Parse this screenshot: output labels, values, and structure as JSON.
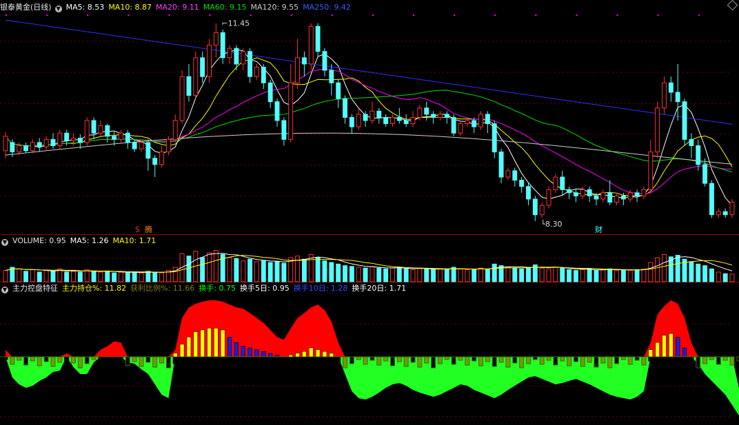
{
  "colors": {
    "up": "#ff3232",
    "down": "#54fcfc",
    "ma5": "#ffffff",
    "ma10": "#ffff00",
    "ma20": "#ff00ff",
    "ma60": "#00e000",
    "ma120": "#cccccc",
    "ma250": "#3030ff",
    "grid": "#7a0000"
  },
  "main_panel": {
    "title": "银泰黄金(日线)",
    "ma": [
      {
        "label": "MA5: 8.53",
        "color": "#ffffff"
      },
      {
        "label": "MA10: 8.87",
        "color": "#ffff00"
      },
      {
        "label": "MA20: 9.11",
        "color": "#ff40ff"
      },
      {
        "label": "MA60: 9.15",
        "color": "#00e000"
      },
      {
        "label": "MA120: 9.55",
        "color": "#cccccc"
      },
      {
        "label": "MA250: 9.42",
        "color": "#3a5cff"
      }
    ],
    "high_label": "11.45",
    "low_label": "8.30",
    "markers": [
      "S",
      "腾",
      "财"
    ]
  },
  "volume_panel": {
    "title": "VOLUME: 0.95",
    "ma": [
      {
        "label": "MA5: 1.26",
        "color": "#ffffff"
      },
      {
        "label": "MA10: 1.71",
        "color": "#ffff00"
      }
    ]
  },
  "indicator_panel": {
    "title": "主力控盘特征",
    "items": [
      {
        "label": "主力持仓%: 11.82",
        "color": "#ffff00"
      },
      {
        "label": "获利比例%: 11.66",
        "color": "#808000"
      },
      {
        "label": "换手: 0.75",
        "color": "#00ff00"
      },
      {
        "label": "换手5日: 0.95",
        "color": "#ffffff"
      },
      {
        "label": "换手10日: 1.28",
        "color": "#3050ff"
      },
      {
        "label": "换手20日: 1.71",
        "color": "#ffffff"
      }
    ]
  },
  "chart_data": {
    "type": "candlestick",
    "price_axis_range": [
      8.2,
      11.6
    ],
    "candles": [
      [
        9.42,
        9.65,
        9.3,
        9.72
      ],
      [
        9.55,
        9.4,
        9.32,
        9.6
      ],
      [
        9.4,
        9.5,
        9.35,
        9.55
      ],
      [
        9.5,
        9.42,
        9.38,
        9.55
      ],
      [
        9.42,
        9.55,
        9.38,
        9.6
      ],
      [
        9.55,
        9.48,
        9.4,
        9.62
      ],
      [
        9.48,
        9.6,
        9.42,
        9.65
      ],
      [
        9.6,
        9.5,
        9.45,
        9.7
      ],
      [
        9.5,
        9.7,
        9.45,
        9.75
      ],
      [
        9.7,
        9.58,
        9.5,
        9.75
      ],
      [
        9.58,
        9.62,
        9.5,
        9.7
      ],
      [
        9.62,
        9.55,
        9.45,
        9.68
      ],
      [
        9.55,
        9.9,
        9.5,
        9.95
      ],
      [
        9.9,
        9.7,
        9.6,
        9.95
      ],
      [
        9.7,
        9.82,
        9.65,
        9.9
      ],
      [
        9.82,
        9.65,
        9.55,
        9.85
      ],
      [
        9.65,
        9.6,
        9.5,
        9.72
      ],
      [
        9.6,
        9.7,
        9.55,
        9.75
      ],
      [
        9.7,
        9.55,
        9.45,
        9.75
      ],
      [
        9.55,
        9.45,
        9.4,
        9.6
      ],
      [
        9.45,
        9.55,
        9.4,
        9.6
      ],
      [
        9.55,
        9.3,
        9.1,
        9.6
      ],
      [
        9.3,
        9.2,
        9.0,
        9.35
      ],
      [
        9.2,
        9.4,
        9.15,
        9.5
      ],
      [
        9.4,
        9.6,
        9.35,
        9.65
      ],
      [
        9.6,
        9.9,
        9.55,
        10.0
      ],
      [
        9.9,
        10.6,
        9.85,
        10.7
      ],
      [
        10.6,
        10.3,
        10.2,
        10.8
      ],
      [
        10.3,
        10.9,
        10.25,
        11.0
      ],
      [
        10.9,
        10.6,
        10.5,
        11.0
      ],
      [
        10.6,
        11.1,
        10.5,
        11.2
      ],
      [
        11.1,
        11.3,
        10.9,
        11.45
      ],
      [
        11.3,
        10.9,
        10.8,
        11.35
      ],
      [
        10.9,
        11.05,
        10.8,
        11.1
      ],
      [
        11.05,
        10.8,
        10.7,
        11.1
      ],
      [
        10.8,
        11.0,
        10.7,
        11.05
      ],
      [
        11.0,
        10.6,
        10.5,
        11.05
      ],
      [
        10.6,
        10.75,
        10.55,
        10.8
      ],
      [
        10.75,
        10.5,
        10.4,
        10.8
      ],
      [
        10.5,
        10.2,
        10.1,
        10.55
      ],
      [
        10.2,
        9.9,
        9.8,
        10.25
      ],
      [
        9.9,
        9.6,
        9.5,
        9.95
      ],
      [
        9.6,
        10.5,
        9.55,
        10.8
      ],
      [
        10.5,
        10.9,
        10.4,
        11.2
      ],
      [
        10.9,
        10.8,
        10.6,
        11.0
      ],
      [
        10.8,
        11.4,
        10.7,
        11.45
      ],
      [
        11.4,
        11.0,
        10.9,
        11.45
      ],
      [
        11.0,
        10.7,
        10.6,
        11.05
      ],
      [
        10.7,
        10.5,
        10.3,
        10.8
      ],
      [
        10.5,
        10.25,
        10.1,
        10.55
      ],
      [
        10.25,
        9.95,
        9.85,
        10.3
      ],
      [
        9.95,
        9.8,
        9.7,
        10.0
      ],
      [
        9.8,
        10.0,
        9.75,
        10.1
      ],
      [
        10.0,
        9.9,
        9.8,
        10.05
      ],
      [
        9.9,
        10.05,
        9.85,
        10.2
      ],
      [
        10.05,
        9.95,
        9.85,
        10.1
      ],
      [
        9.95,
        9.85,
        9.8,
        10.0
      ],
      [
        9.85,
        9.95,
        9.8,
        10.0
      ],
      [
        9.95,
        9.9,
        9.85,
        10.1
      ],
      [
        9.9,
        9.85,
        9.8,
        10.0
      ],
      [
        9.85,
        9.95,
        9.8,
        10.05
      ],
      [
        9.95,
        10.1,
        9.9,
        10.15
      ],
      [
        10.1,
        10.0,
        9.9,
        10.2
      ],
      [
        10.0,
        9.95,
        9.85,
        10.05
      ],
      [
        9.95,
        10.0,
        9.9,
        10.05
      ],
      [
        10.0,
        9.95,
        9.85,
        10.05
      ],
      [
        9.95,
        9.7,
        9.65,
        10.0
      ],
      [
        9.7,
        9.85,
        9.65,
        9.9
      ],
      [
        9.85,
        9.9,
        9.8,
        9.95
      ],
      [
        9.9,
        9.8,
        9.7,
        9.95
      ],
      [
        9.8,
        10.0,
        9.75,
        10.05
      ],
      [
        10.0,
        9.85,
        9.7,
        10.05
      ],
      [
        9.85,
        9.4,
        9.3,
        9.9
      ],
      [
        9.4,
        9.0,
        8.9,
        9.45
      ],
      [
        9.0,
        9.1,
        8.95,
        9.15
      ],
      [
        9.1,
        8.95,
        8.85,
        9.15
      ],
      [
        8.95,
        8.85,
        8.75,
        9.0
      ],
      [
        8.85,
        8.65,
        8.55,
        8.9
      ],
      [
        8.65,
        8.4,
        8.3,
        8.7
      ],
      [
        8.4,
        8.55,
        8.35,
        8.6
      ],
      [
        8.55,
        8.8,
        8.5,
        8.85
      ],
      [
        8.8,
        9.0,
        8.75,
        9.05
      ],
      [
        9.0,
        8.8,
        8.7,
        9.1
      ],
      [
        8.8,
        8.75,
        8.65,
        8.85
      ],
      [
        8.75,
        8.7,
        8.6,
        8.8
      ],
      [
        8.7,
        8.8,
        8.65,
        8.85
      ],
      [
        8.8,
        8.7,
        8.6,
        8.85
      ],
      [
        8.7,
        8.65,
        8.55,
        8.75
      ],
      [
        8.65,
        8.75,
        8.6,
        8.8
      ],
      [
        8.75,
        8.6,
        8.55,
        8.95
      ],
      [
        8.6,
        8.7,
        8.55,
        8.75
      ],
      [
        8.7,
        8.65,
        8.55,
        8.75
      ],
      [
        8.65,
        8.75,
        8.6,
        8.8
      ],
      [
        8.75,
        8.7,
        8.6,
        8.8
      ],
      [
        8.7,
        8.8,
        8.65,
        8.85
      ],
      [
        8.8,
        9.4,
        8.75,
        9.6
      ],
      [
        9.4,
        10.1,
        9.3,
        10.2
      ],
      [
        10.1,
        10.5,
        10.0,
        10.6
      ],
      [
        10.5,
        10.35,
        10.2,
        10.6
      ],
      [
        10.35,
        10.2,
        9.9,
        10.8
      ],
      [
        10.2,
        9.6,
        9.5,
        10.25
      ],
      [
        9.6,
        9.5,
        9.3,
        9.7
      ],
      [
        9.5,
        9.2,
        9.1,
        9.6
      ],
      [
        9.2,
        8.9,
        8.85,
        9.3
      ],
      [
        8.9,
        8.4,
        8.35,
        8.95
      ],
      [
        8.4,
        8.45,
        8.35,
        8.5
      ],
      [
        8.45,
        8.4,
        8.35,
        8.5
      ],
      [
        8.4,
        8.6,
        8.35,
        8.65
      ]
    ],
    "volume": [
      1.4,
      1.8,
      1.6,
      1.3,
      1.5,
      1.2,
      1.4,
      1.3,
      1.6,
      1.2,
      1.3,
      1.2,
      1.5,
      1.3,
      1.2,
      1.3,
      1.1,
      1.2,
      1.1,
      1.2,
      1.1,
      1.3,
      1.2,
      1.1,
      1.4,
      1.8,
      3.5,
      3.2,
      3.8,
      3.0,
      3.6,
      3.9,
      3.4,
      3.0,
      2.9,
      2.6,
      2.8,
      2.5,
      2.6,
      2.4,
      2.5,
      2.3,
      3.0,
      3.2,
      2.8,
      3.4,
      3.0,
      2.6,
      2.4,
      2.2,
      2.0,
      1.9,
      1.8,
      1.7,
      1.9,
      1.7,
      1.6,
      1.7,
      1.8,
      1.6,
      1.5,
      1.7,
      1.6,
      1.5,
      1.6,
      1.5,
      1.8,
      1.6,
      1.5,
      1.5,
      1.7,
      1.6,
      2.2,
      2.0,
      1.8,
      1.7,
      1.6,
      1.8,
      2.1,
      1.7,
      1.6,
      1.8,
      1.7,
      1.5,
      1.4,
      1.5,
      1.6,
      1.4,
      1.5,
      1.6,
      1.4,
      1.5,
      1.4,
      1.5,
      1.6,
      2.4,
      3.0,
      3.4,
      3.1,
      3.3,
      2.8,
      2.5,
      2.2,
      2.0,
      1.6,
      1.2,
      1.0,
      0.95
    ],
    "indicator": {
      "holding_pct": [
        0,
        0,
        0,
        0,
        0,
        0,
        0,
        0,
        0,
        0,
        0,
        0,
        0,
        0,
        0,
        0,
        0,
        0,
        0,
        0,
        0,
        0,
        0,
        0,
        0,
        4,
        14,
        22,
        28,
        30,
        32,
        32,
        30,
        22,
        16,
        12,
        10,
        8,
        6,
        4,
        2,
        0,
        2,
        4,
        6,
        10,
        8,
        6,
        4,
        0,
        0,
        0,
        0,
        0,
        0,
        0,
        0,
        0,
        0,
        0,
        0,
        0,
        0,
        0,
        0,
        0,
        0,
        0,
        0,
        0,
        0,
        0,
        0,
        0,
        0,
        0,
        0,
        0,
        0,
        0,
        0,
        0,
        0,
        0,
        0,
        0,
        0,
        0,
        0,
        0,
        0,
        0,
        0,
        0,
        0,
        0,
        0,
        0,
        0,
        0,
        0,
        0,
        0,
        0,
        0,
        0,
        0,
        0,
        0,
        0,
        0,
        0
      ],
      "profit_pct": [
        10,
        -30,
        -40,
        -45,
        -42,
        -35,
        -30,
        -22,
        -20,
        5,
        -15,
        -25,
        -25,
        -8,
        10,
        15,
        22,
        20,
        -8,
        -10,
        -18,
        -25,
        -40,
        -55,
        -60,
        10,
        55,
        70,
        75,
        78,
        80,
        80,
        78,
        74,
        70,
        68,
        62,
        55,
        48,
        38,
        28,
        24,
        40,
        55,
        62,
        70,
        74,
        66,
        50,
        20,
        -25,
        -50,
        -60,
        -62,
        -58,
        -52,
        -45,
        -40,
        -38,
        -42,
        -48,
        -52,
        -55,
        -58,
        -55,
        -50,
        -45,
        -40,
        -42,
        -48,
        -52,
        -56,
        -60,
        -55,
        -48,
        -42,
        -36,
        -30,
        -28,
        -32,
        -36,
        -40,
        -38,
        -35,
        -32,
        -36,
        -40,
        -45,
        -50,
        -55,
        -58,
        -60,
        -62,
        -58,
        -50,
        20,
        60,
        72,
        80,
        75,
        55,
        20,
        -10,
        -25,
        -35,
        -45,
        -55,
        -70,
        -85,
        -90
      ]
    }
  }
}
